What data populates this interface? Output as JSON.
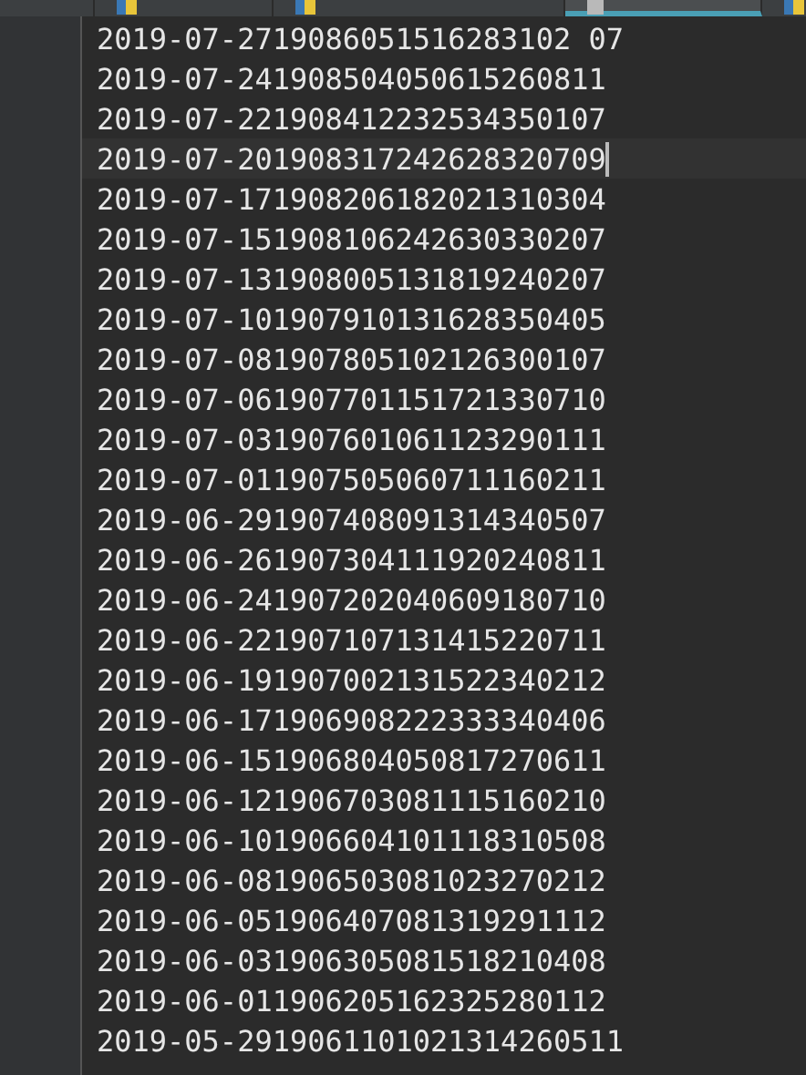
{
  "tabs": [
    {
      "kind": "plain",
      "selected": false
    },
    {
      "kind": "python",
      "selected": false
    },
    {
      "kind": "python",
      "selected": false
    },
    {
      "kind": "text",
      "selected": true
    },
    {
      "kind": "python",
      "selected": false
    }
  ],
  "editor": {
    "lines": [
      {
        "text": "2019-07-2719086051516283102 07",
        "current": false
      },
      {
        "text": "2019-07-241908504050615260811",
        "current": false
      },
      {
        "text": "2019-07-221908412232534350107",
        "current": false
      },
      {
        "text": "2019-07-201908317242628320709",
        "current": true
      },
      {
        "text": "2019-07-171908206182021310304",
        "current": false
      },
      {
        "text": "2019-07-151908106242630330207",
        "current": false
      },
      {
        "text": "2019-07-131908005131819240207",
        "current": false
      },
      {
        "text": "2019-07-101907910131628350405",
        "current": false
      },
      {
        "text": "2019-07-081907805102126300107",
        "current": false
      },
      {
        "text": "2019-07-061907701151721330710",
        "current": false
      },
      {
        "text": "2019-07-031907601061123290111",
        "current": false
      },
      {
        "text": "2019-07-011907505060711160211",
        "current": false
      },
      {
        "text": "2019-06-291907408091314340507",
        "current": false
      },
      {
        "text": "2019-06-261907304111920240811",
        "current": false
      },
      {
        "text": "2019-06-241907202040609180710",
        "current": false
      },
      {
        "text": "2019-06-221907107131415220711",
        "current": false
      },
      {
        "text": "2019-06-191907002131522340212",
        "current": false
      },
      {
        "text": "2019-06-171906908222333340406",
        "current": false
      },
      {
        "text": "2019-06-151906804050817270611",
        "current": false
      },
      {
        "text": "2019-06-121906703081115160210",
        "current": false
      },
      {
        "text": "2019-06-101906604101118310508",
        "current": false
      },
      {
        "text": "2019-06-081906503081023270212",
        "current": false
      },
      {
        "text": "2019-06-051906407081319291112",
        "current": false
      },
      {
        "text": "2019-06-031906305081518210408",
        "current": false
      },
      {
        "text": "2019-06-011906205162325280112",
        "current": false
      },
      {
        "text": "2019-05-2919061101021314260511",
        "current": false
      }
    ]
  }
}
